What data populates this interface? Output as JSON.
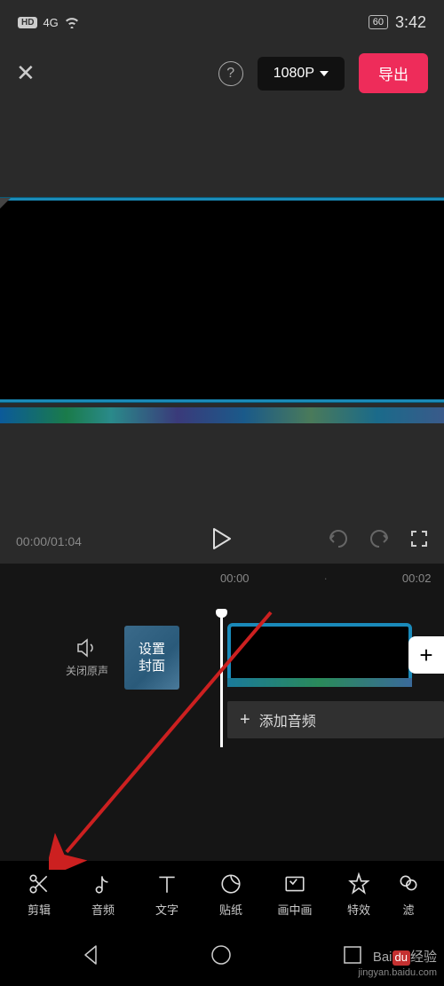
{
  "status": {
    "hd": "HD",
    "network": "4G",
    "battery": "60",
    "time": "3:42"
  },
  "topbar": {
    "resolution": "1080P",
    "export_label": "导出"
  },
  "playback": {
    "current": "00:00",
    "total": "01:04"
  },
  "timeline": {
    "ruler": [
      "00:00",
      "00:02"
    ],
    "mute_label": "关闭原声",
    "cover_label": "设置\n封面",
    "add_audio_label": "添加音频"
  },
  "tools": [
    {
      "name": "edit",
      "label": "剪辑"
    },
    {
      "name": "audio",
      "label": "音频"
    },
    {
      "name": "text",
      "label": "文字"
    },
    {
      "name": "sticker",
      "label": "贴纸"
    },
    {
      "name": "pip",
      "label": "画中画"
    },
    {
      "name": "effect",
      "label": "特效"
    },
    {
      "name": "filter",
      "label": "滤"
    }
  ],
  "watermark": {
    "brand_prefix": "Bai",
    "brand_mid": "du",
    "brand_suffix": "经验",
    "url": "jingyan.baidu.com"
  },
  "colors": {
    "accent": "#ee2c5a",
    "clip_border": "#1a8aba"
  }
}
